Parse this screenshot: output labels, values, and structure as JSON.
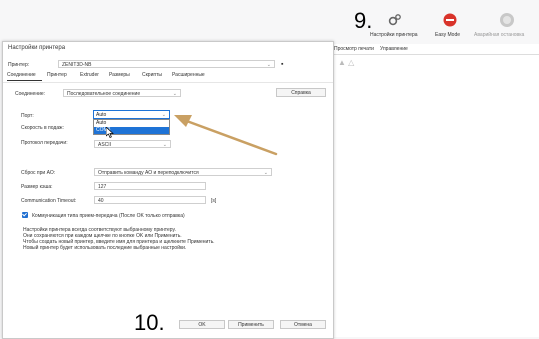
{
  "toolbar": {
    "step9": "9.",
    "printer_settings": "Настройки принтера",
    "easy_mode": "Easy Mode",
    "emergency_stop": "Аварийная остановка"
  },
  "step10": "10.",
  "behind": {
    "menu": [
      "Просмотр печати",
      "Управление"
    ]
  },
  "dialog": {
    "title": "Настройки принтера",
    "printer_label": "Принтер:",
    "printer_value": "ZENIT3D-NB",
    "tabs": [
      "Соединение",
      "Принтер",
      "Extruder",
      "Размеры",
      "Скрипты",
      "Расширенные"
    ],
    "connection_label": "Соединение:",
    "connection_value": "Последовательное соединение",
    "help_button": "Справка",
    "port_label": "Порт:",
    "port_value": "Auto",
    "port_options": [
      "Auto",
      "COM3"
    ],
    "speed_label": "Скорость в подаж:",
    "protocol_label": "Протокол передачи:",
    "protocol_value": "ASCII",
    "reset_label": "Сброс при АО:",
    "reset_value": "Отправить команду АО и переподключится",
    "queue_label": "Размер кэша:",
    "queue_value": "127",
    "timeout_label": "Communication Timeout:",
    "timeout_value": "40",
    "timeout_unit": "[s]",
    "checkbox_label": "Коммуникация типа прием-передача (После OK только отправка)",
    "notes": [
      "Настройки принтера всегда соответствуют выбранному принтеру.",
      "Они сохраняются при каждом щелчке по кнопке OK или Применить.",
      "Чтобы создать новый принтер, введите имя для принтера и щелкните Применить.",
      "Новый принтер будет использовать последние выбранные настройки."
    ],
    "ok": "OK",
    "apply": "Применить",
    "cancel": "Отмена"
  },
  "colors": {
    "accent": "#1e73d6",
    "arrow": "#c9a063"
  }
}
